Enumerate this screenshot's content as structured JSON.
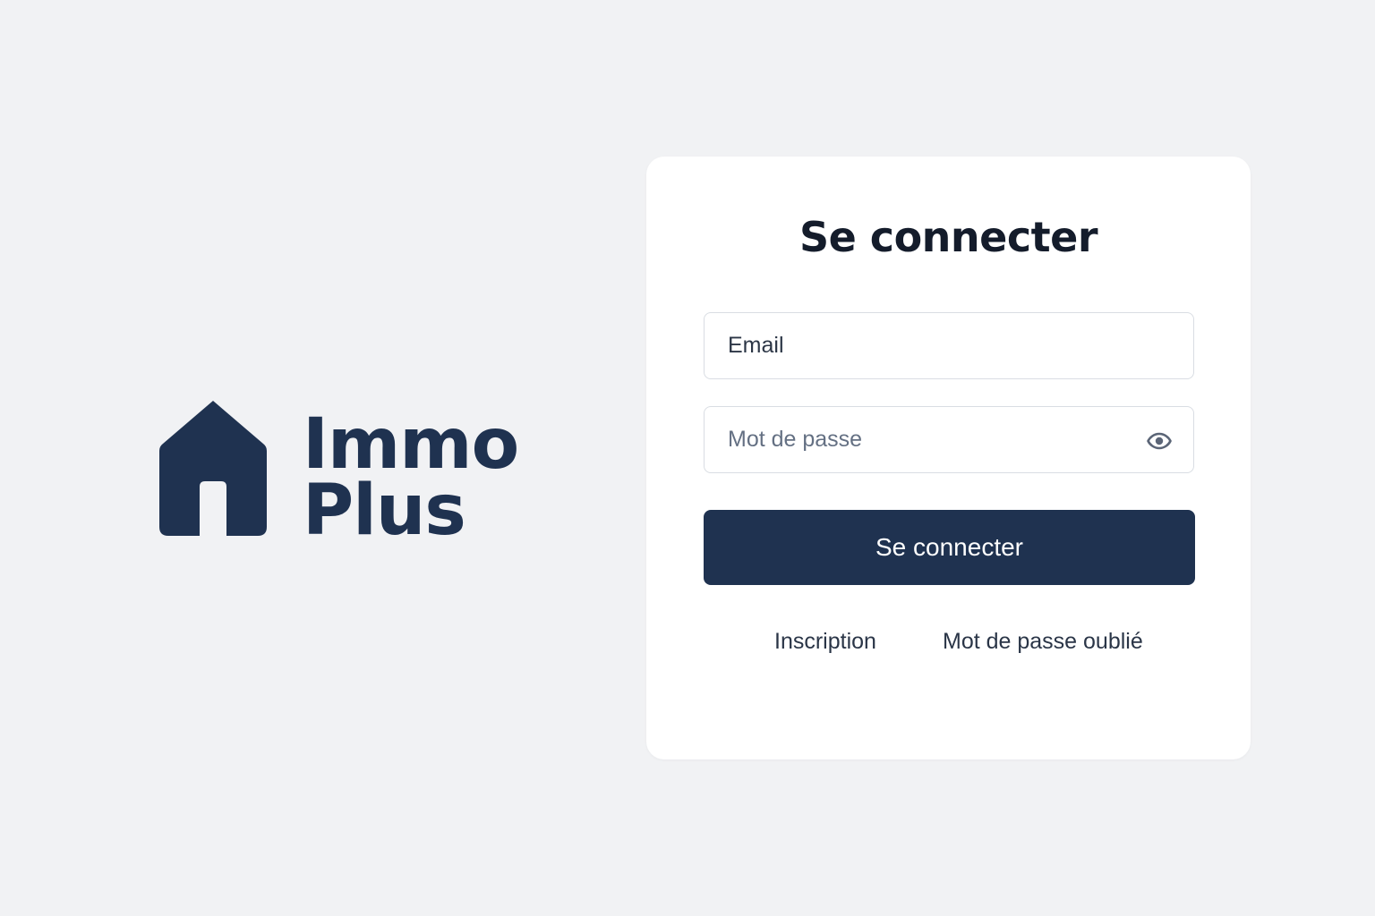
{
  "brand": {
    "line1": "Immo",
    "line2": "Plus",
    "icon": "house-icon",
    "color": "#1f3250"
  },
  "login": {
    "title": "Se connecter",
    "email": {
      "value": "",
      "placeholder": "Email"
    },
    "password": {
      "value": "",
      "placeholder": "Mot de passe",
      "toggle_icon": "eye-icon"
    },
    "submit_label": "Se connecter",
    "links": {
      "signup": "Inscription",
      "forgot": "Mot de passe oublié"
    }
  },
  "colors": {
    "background": "#f1f2f4",
    "card": "#ffffff",
    "primary": "#1f3250",
    "title_text": "#141c2b",
    "placeholder": "#647083",
    "border": "#d9dde3"
  }
}
